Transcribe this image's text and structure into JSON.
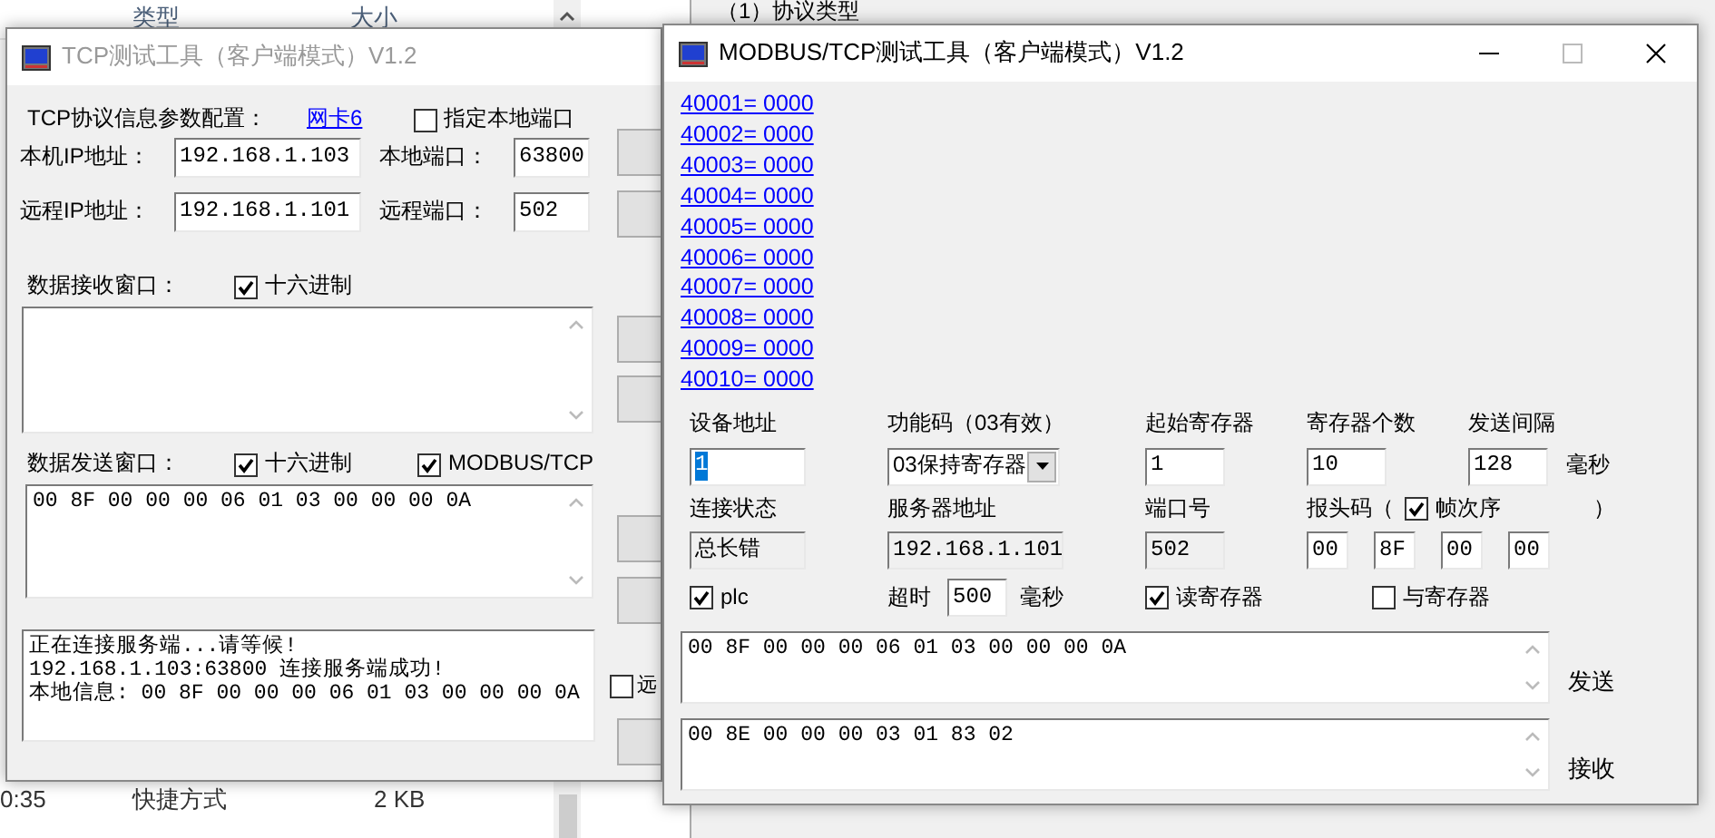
{
  "explorer": {
    "columns": [
      "类型",
      "大小"
    ],
    "rows": [
      {
        "time": "0:35",
        "type": "快捷方式",
        "size": "2 KB"
      }
    ]
  },
  "config_window": {
    "heading": "（1）协议类型"
  },
  "tcp_window": {
    "title": "TCP测试工具（客户端模式）V1.2",
    "active": false,
    "config_label": "TCP协议信息参数配置：",
    "nic_link": "网卡6",
    "local_port_option": {
      "label": "指定本地端口",
      "checked": false
    },
    "address_rows": [
      {
        "label": "本机IP地址：",
        "value": "192.168.1.103",
        "port_label": "本地端口：",
        "port": "63800"
      },
      {
        "label": "远程IP地址：",
        "value": "192.168.1.101",
        "port_label": "远程端口：",
        "port": "502"
      }
    ],
    "receive": {
      "label": "数据接收窗口：",
      "options": [
        {
          "label": "十六进制",
          "checked": true
        }
      ]
    },
    "send": {
      "label": "数据发送窗口：",
      "options": [
        {
          "label": "十六进制",
          "checked": true
        },
        {
          "label": "MODBUS/TCP",
          "checked": true
        }
      ],
      "text": "00 8F 00 00 00 06 01 03 00 00 00 0A"
    },
    "log": [
      "正在连接服务端...请等候!",
      "192.168.1.103:63800 连接服务端成功!",
      "本地信息: 00 8F 00 00 00 06 01 03 00 00 00 0A"
    ],
    "side_option": {
      "label": "远",
      "checked": false
    }
  },
  "modbus_window": {
    "title": "MODBUS/TCP测试工具（客户端模式）V1.2",
    "active": true,
    "registers": [
      "40001= 0000",
      "40002= 0000",
      "40003= 0000",
      "40004= 0000",
      "40005= 0000",
      "40006= 0000",
      "40007= 0000",
      "40008= 0000",
      "40009= 0000",
      "40010= 0000"
    ],
    "device_address": {
      "label": "设备地址",
      "value": "1",
      "text_selected": true
    },
    "function_code": {
      "label": "功能码（03有效）",
      "value": "03保持寄存器"
    },
    "start_register": {
      "label": "起始寄存器",
      "value": "1"
    },
    "register_count": {
      "label": "寄存器个数",
      "value": "10"
    },
    "send_interval": {
      "label": "发送间隔",
      "value": "128",
      "unit": "毫秒"
    },
    "connection_status": {
      "label": "连接状态",
      "value": "总长错"
    },
    "server_address": {
      "label": "服务器地址",
      "value": "192.168.1.101"
    },
    "port": {
      "label": "端口号",
      "value": "502"
    },
    "header": {
      "label": "报头码（",
      "frame_order": {
        "label": "帧次序",
        "checked": true
      },
      "closing": "）",
      "bytes": [
        "00",
        "8F",
        "00",
        "00"
      ]
    },
    "plc": {
      "label": "plc",
      "checked": true
    },
    "timeout": {
      "label": "超时",
      "value": "500",
      "unit": "毫秒"
    },
    "read_register": {
      "label": "读寄存器",
      "checked": true
    },
    "and_register": {
      "label": "与寄存器",
      "checked": false
    },
    "send": {
      "text": "00 8F 00 00 00 06 01 03 00 00 00 0A",
      "label": "发送"
    },
    "receive": {
      "text": "00 8E 00 00 00 03 01 83 02",
      "label": "接收"
    }
  }
}
